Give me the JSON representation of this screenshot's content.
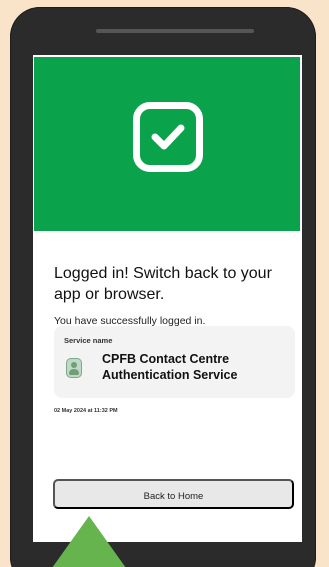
{
  "screen": {
    "status_icon": "check-icon",
    "title": "Logged in! Switch back to your app or browser.",
    "subtitle": "You have successfully logged in.",
    "service": {
      "label": "Service name",
      "name": "CPFB Contact Centre Authentication Service",
      "avatar_icon": "service-avatar-icon"
    },
    "timestamp": "02 May 2024 at 11:32 PM",
    "back_button_label": "Back to Home"
  },
  "colors": {
    "success_green": "#0aa24a",
    "triangle_green": "#65b44e",
    "phone_body": "#2b2b2b",
    "card_background": "#f3f3f3",
    "button_background": "#e8e8e8"
  }
}
